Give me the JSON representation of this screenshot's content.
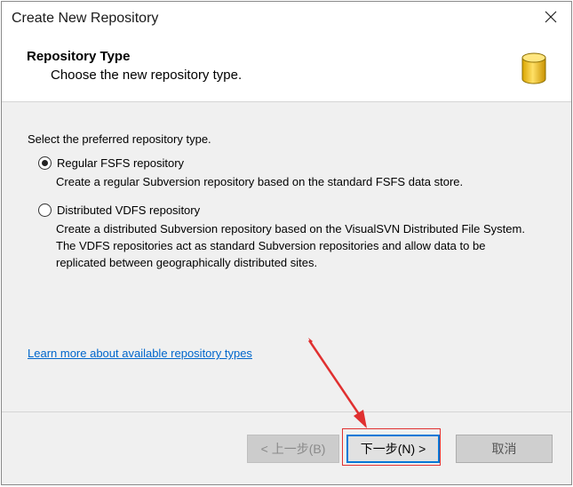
{
  "window": {
    "title": "Create New Repository",
    "close_glyph": "✕"
  },
  "header": {
    "title": "Repository Type",
    "subtitle": "Choose the new repository type."
  },
  "content": {
    "prompt": "Select the preferred repository type.",
    "options": [
      {
        "label": "Regular FSFS repository",
        "selected": true,
        "description": "Create a regular Subversion repository based on the standard FSFS data store."
      },
      {
        "label": "Distributed VDFS repository",
        "selected": false,
        "description": "Create a distributed Subversion repository based on the VisualSVN Distributed File System. The VDFS repositories act as standard Subversion repositories and allow data to be replicated between geographically distributed sites."
      }
    ],
    "learn_more_link": "Learn more about available repository types"
  },
  "footer": {
    "back_label": "< 上一步(B)",
    "next_label": "下一步(N) >",
    "cancel_label": "取消"
  },
  "icons": {
    "header_icon": "database-icon",
    "close": "close-icon"
  },
  "colors": {
    "link": "#0066cc",
    "focus_border": "#0078d7",
    "annotation_red": "#e03030",
    "db_icon_yellow": "#f5c518"
  }
}
